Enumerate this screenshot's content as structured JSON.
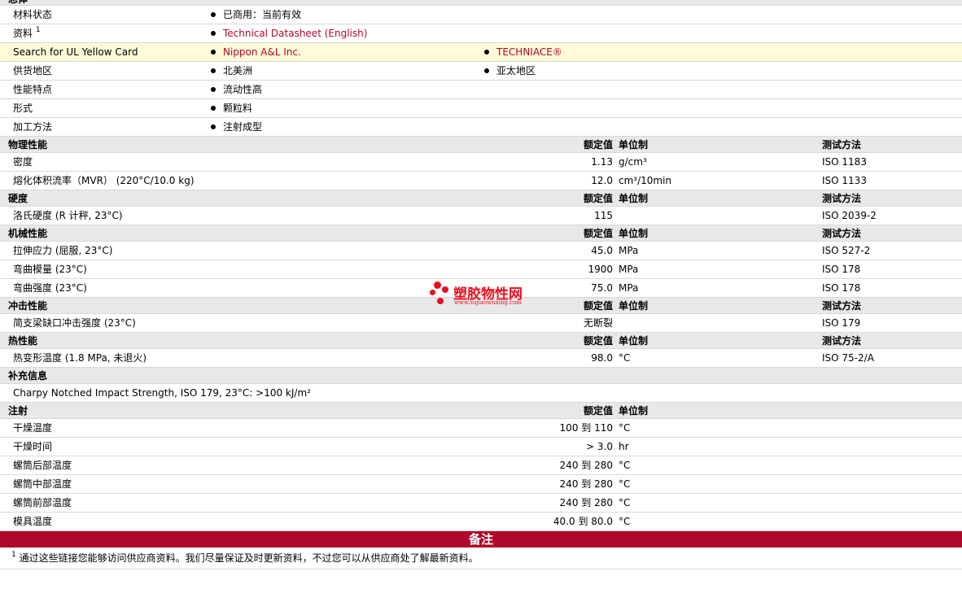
{
  "top_section": "总体",
  "info": [
    {
      "label": "材料状态",
      "v1": "已商用：当前有效",
      "v1_link": false
    },
    {
      "label": "资料",
      "sup": "1",
      "v1": "Technical Datasheet (English)",
      "v1_link": true
    },
    {
      "label": "Search for UL Yellow Card",
      "v1": "Nippon A&L Inc.",
      "v1_link": true,
      "v2": "TECHNIACE®",
      "v2_link": true,
      "highlight": true
    },
    {
      "label": "供货地区",
      "v1": "北美洲",
      "v1_link": false,
      "v2": "亚太地区",
      "v2_link": false
    },
    {
      "label": "性能特点",
      "v1": "流动性高",
      "v1_link": false
    },
    {
      "label": "形式",
      "v1": "颗粒料",
      "v1_link": false
    },
    {
      "label": "加工方法",
      "v1": "注射成型",
      "v1_link": false
    }
  ],
  "headers": {
    "value": "额定值",
    "unit": "单位制",
    "method": "测试方法"
  },
  "sections": [
    {
      "name": "物理性能",
      "show_method": true,
      "rows": [
        {
          "name": "密度",
          "value": "1.13",
          "unit": "g/cm³",
          "method": "ISO 1183"
        },
        {
          "name": "熔化体积流率（MVR） (220°C/10.0 kg)",
          "value": "12.0",
          "unit": "cm³/10min",
          "method": "ISO 1133"
        }
      ]
    },
    {
      "name": "硬度",
      "show_method": true,
      "rows": [
        {
          "name": "洛氏硬度 (R 计秤, 23°C)",
          "value": "115",
          "unit": "",
          "method": "ISO 2039-2"
        }
      ]
    },
    {
      "name": "机械性能",
      "show_method": true,
      "rows": [
        {
          "name": "拉伸应力 (屈服, 23°C)",
          "value": "45.0",
          "unit": "MPa",
          "method": "ISO 527-2"
        },
        {
          "name": "弯曲模量 (23°C)",
          "value": "1900",
          "unit": "MPa",
          "method": "ISO 178"
        },
        {
          "name": "弯曲强度 (23°C)",
          "value": "75.0",
          "unit": "MPa",
          "method": "ISO 178"
        }
      ]
    },
    {
      "name": "冲击性能",
      "show_method": true,
      "rows": [
        {
          "name": "简支梁缺口冲击强度 (23°C)",
          "value": "无断裂",
          "unit": "",
          "method": "ISO 179"
        }
      ]
    },
    {
      "name": "热性能",
      "show_method": true,
      "rows": [
        {
          "name": "热变形温度 (1.8 MPa, 未退火)",
          "value": "98.0",
          "unit": "°C",
          "method": "ISO 75-2/A"
        }
      ]
    }
  ],
  "supplement": {
    "name": "补充信息",
    "text": "Charpy Notched Impact Strength, ISO 179, 23°C: >100 kJ/m²"
  },
  "injection": {
    "name": "注射",
    "rows": [
      {
        "name": "干燥温度",
        "value": "100 到  110",
        "unit": "°C"
      },
      {
        "name": "干燥时间",
        "value": "> 3.0",
        "unit": "hr"
      },
      {
        "name": "螺筒后部温度",
        "value": "240 到  280",
        "unit": "°C"
      },
      {
        "name": "螺筒中部温度",
        "value": "240 到  280",
        "unit": "°C"
      },
      {
        "name": "螺筒前部温度",
        "value": "240 到  280",
        "unit": "°C"
      },
      {
        "name": "模具温度",
        "value": "40.0 到  80.0",
        "unit": "°C"
      }
    ]
  },
  "remarks": {
    "title": "备注",
    "sup": "1",
    "note": "通过这些链接您能够访问供应商资料。我们尽量保证及时更新资料，不过您可以从供应商处了解最新资料。"
  },
  "watermark": {
    "title": "塑胶物性网",
    "url": "www.sujiaowuxing.com"
  },
  "colors": {
    "accent": "#b0082a",
    "highlight": "#fffbd8",
    "section_bg": "#e8e8e8",
    "watermark": "#e8101f"
  }
}
